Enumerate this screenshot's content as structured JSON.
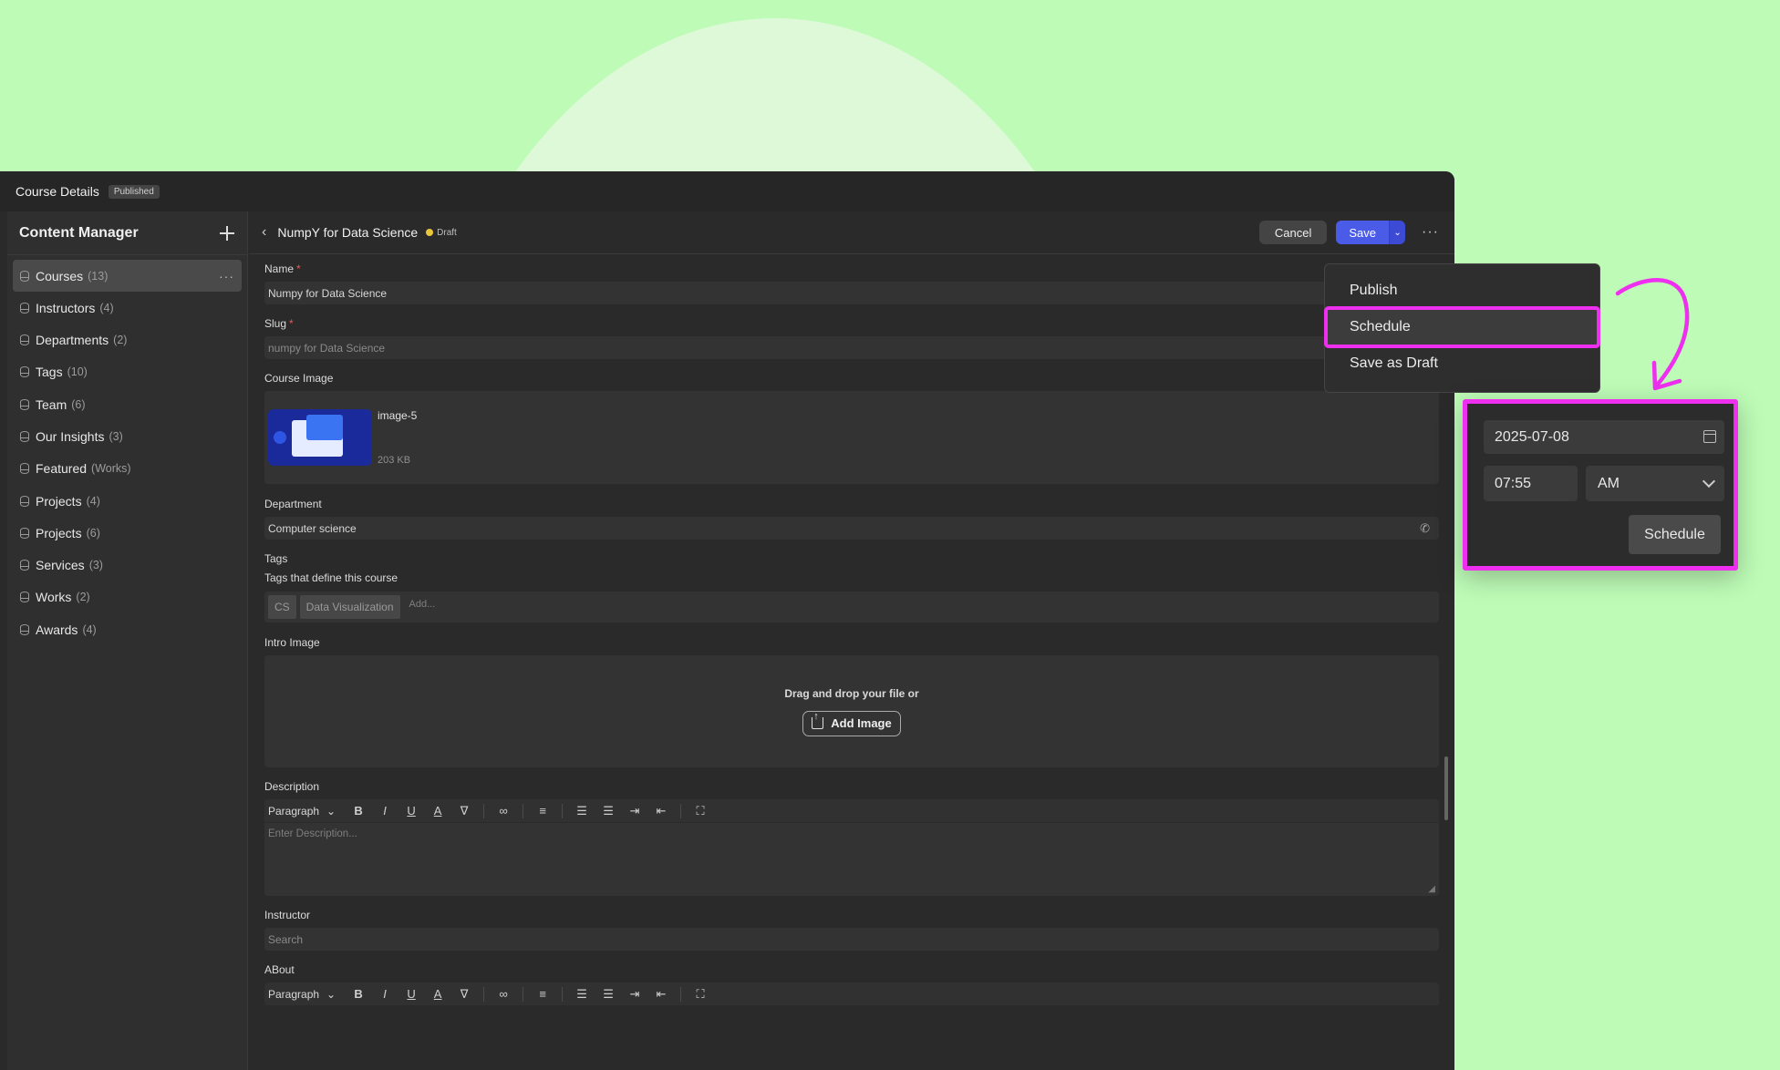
{
  "window": {
    "title": "Course Details",
    "status_badge": "Published"
  },
  "sidebar": {
    "heading": "Content Manager",
    "items": [
      {
        "label": "Courses",
        "count": "(13)"
      },
      {
        "label": "Instructors",
        "count": "(4)"
      },
      {
        "label": "Departments",
        "count": "(2)"
      },
      {
        "label": "Tags",
        "count": "(10)"
      },
      {
        "label": "Team",
        "count": "(6)"
      },
      {
        "label": "Our Insights",
        "count": "(3)"
      },
      {
        "label": "Featured",
        "count": "(Works)"
      },
      {
        "label": "Projects",
        "count": "(4)"
      },
      {
        "label": "Projects",
        "count": "(6)"
      },
      {
        "label": "Services",
        "count": "(3)"
      },
      {
        "label": "Works",
        "count": "(2)"
      },
      {
        "label": "Awards",
        "count": "(4)"
      }
    ],
    "more_dots": "···"
  },
  "topbar": {
    "title": "NumpY for Data Science",
    "status": "Draft",
    "cancel_label": "Cancel",
    "save_label": "Save"
  },
  "form": {
    "name_label": "Name",
    "name_value": "Numpy for Data Science",
    "slug_label": "Slug",
    "slug_placeholder": "numpy for Data Science",
    "course_image_label": "Course Image",
    "image_name": "image-5",
    "image_size": "203 KB",
    "department_label": "Department",
    "department_value": "Computer science",
    "tags_label": "Tags",
    "tags_sub": "Tags that define this course",
    "tags": [
      "CS",
      "Data Visualization"
    ],
    "tags_add_placeholder": "Add...",
    "intro_label": "Intro Image",
    "drop_text": "Drag and drop your file or",
    "add_image_label": "Add Image",
    "description_label": "Description",
    "paragraph_label": "Paragraph",
    "description_placeholder": "Enter Description...",
    "instructor_label": "Instructor",
    "instructor_placeholder": "Search",
    "about_label": "ABout",
    "about_paragraph_label": "Paragraph"
  },
  "menu": {
    "items": [
      "Publish",
      "Schedule",
      "Save as Draft"
    ],
    "highlighted": "Schedule"
  },
  "schedule": {
    "date": "2025-07-08",
    "time": "07:55",
    "period": "AM",
    "button_label": "Schedule"
  },
  "colors": {
    "background": "#bdfbb6",
    "accent": "#4a5be8",
    "highlight": "#ef2ff0"
  }
}
